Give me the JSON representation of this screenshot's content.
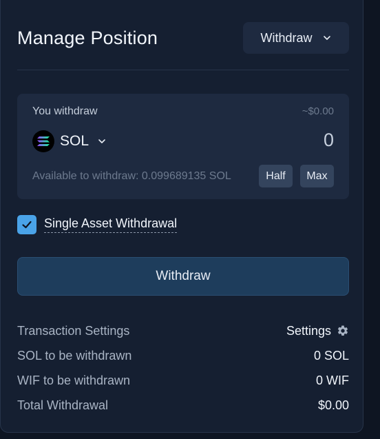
{
  "panel": {
    "title": "Manage Position",
    "mode_select": {
      "value": "Withdraw",
      "icon": "chevron-down-icon"
    }
  },
  "withdraw_card": {
    "label": "You withdraw",
    "usd_value": "~$0.00",
    "token": {
      "symbol": "SOL",
      "icon": "solana-logo"
    },
    "amount": "0",
    "available": "Available to withdraw: 0.099689135 SOL",
    "half_label": "Half",
    "max_label": "Max"
  },
  "single_asset": {
    "label": "Single Asset Withdrawal",
    "checked": true
  },
  "withdraw_button": {
    "label": "Withdraw"
  },
  "summary": [
    {
      "key": "Transaction Settings",
      "value": "Settings",
      "icon": "gear-icon"
    },
    {
      "key": "SOL to be withdrawn",
      "value": "0 SOL"
    },
    {
      "key": "WIF to be withdrawn",
      "value": "0 WIF"
    },
    {
      "key": "Total Withdrawal",
      "value": "$0.00"
    }
  ],
  "colors": {
    "background": "#0e1522",
    "panel": "#151f31",
    "card": "#1e2a40",
    "accent": "#4aa3e8",
    "button": "#1e3d5c"
  }
}
